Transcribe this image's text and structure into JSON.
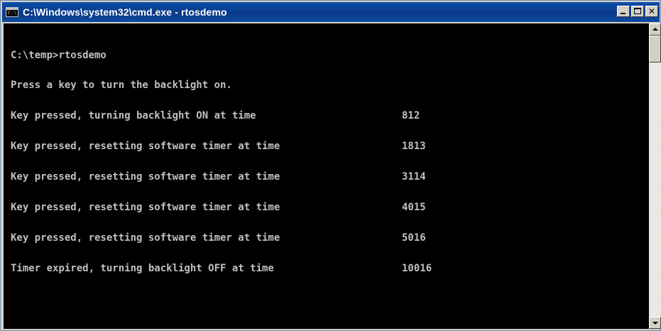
{
  "window": {
    "title": "C:\\Windows\\system32\\cmd.exe - rtosdemo",
    "icon": "cmd-prompt-icon",
    "icon_text": "C:\\.",
    "controls": {
      "minimize": "minimize-icon",
      "maximize": "maximize-icon",
      "close_glyph": "✕"
    }
  },
  "console": {
    "colors": {
      "background": "#000000",
      "text": "#c0c0c0"
    },
    "lines": [
      {
        "text": "C:\\temp>rtosdemo",
        "value": ""
      },
      {
        "text": "Press a key to turn the backlight on.",
        "value": ""
      },
      {
        "text": "Key pressed, turning backlight ON at time",
        "value": "812"
      },
      {
        "text": "Key pressed, resetting software timer at time",
        "value": "1813"
      },
      {
        "text": "Key pressed, resetting software timer at time",
        "value": "3114"
      },
      {
        "text": "Key pressed, resetting software timer at time",
        "value": "4015"
      },
      {
        "text": "Key pressed, resetting software timer at time",
        "value": "5016"
      },
      {
        "text": "Timer expired, turning backlight OFF at time",
        "value": "10016"
      }
    ]
  },
  "scrollbar": {
    "up": "scroll-up-arrow-icon",
    "down": "scroll-down-arrow-icon"
  }
}
